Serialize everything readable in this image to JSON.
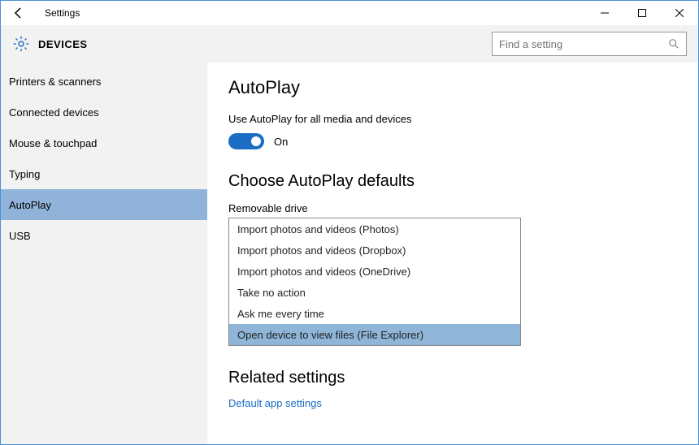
{
  "window": {
    "title": "Settings"
  },
  "header": {
    "section": "DEVICES",
    "search_placeholder": "Find a setting"
  },
  "sidebar": {
    "items": [
      {
        "label": "Printers & scanners"
      },
      {
        "label": "Connected devices"
      },
      {
        "label": "Mouse & touchpad"
      },
      {
        "label": "Typing"
      },
      {
        "label": "AutoPlay"
      },
      {
        "label": "USB"
      }
    ],
    "selected_index": 4
  },
  "main": {
    "title": "AutoPlay",
    "toggle_label": "Use AutoPlay for all media and devices",
    "toggle_state": "On",
    "defaults_heading": "Choose AutoPlay defaults",
    "removable_label": "Removable drive",
    "options": [
      "Import photos and videos (Photos)",
      "Import photos and videos (Dropbox)",
      "Import photos and videos (OneDrive)",
      "Take no action",
      "Ask me every time",
      "Open device to view files (File Explorer)"
    ],
    "highlighted_option_index": 5,
    "related_heading": "Related settings",
    "related_link": "Default app settings"
  }
}
